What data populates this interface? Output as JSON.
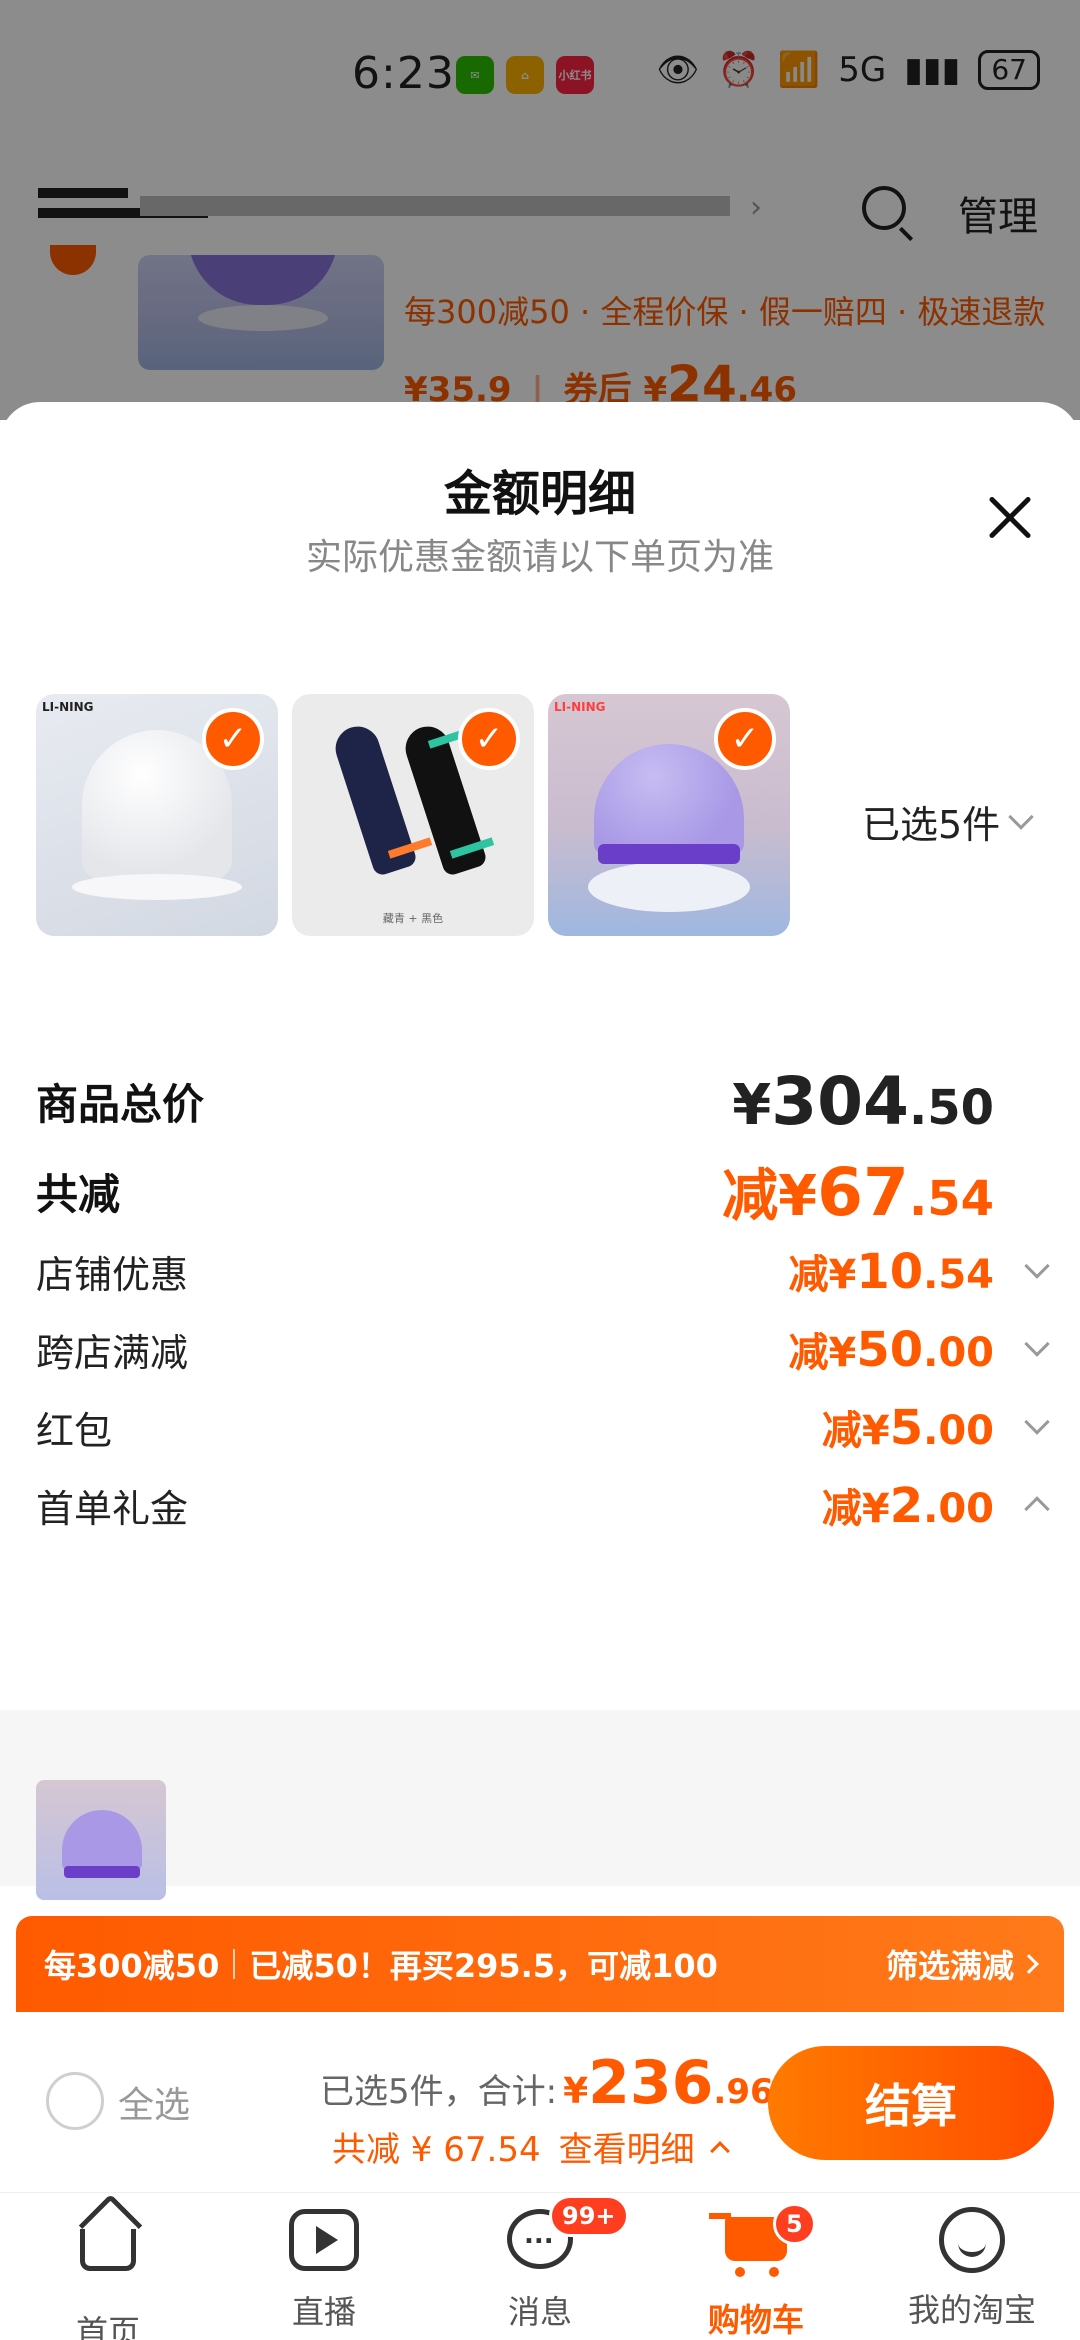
{
  "status_bar": {
    "time": "6:23",
    "apps": [
      "wechat-icon",
      "taobao-icon",
      "xiaohongshu-icon"
    ],
    "xiaohongshu_label": "小红书",
    "network": "5G",
    "battery": "67"
  },
  "background": {
    "manage_label": "管理",
    "item_tags": "每300减50 · 全程价保 · 假一赔四 · 极速退款",
    "item_price": "¥35.9",
    "coupon_label": "券后",
    "coupon_currency": "¥",
    "coupon_price_int": "24",
    "coupon_price_dec": ".46"
  },
  "sheet": {
    "title": "金额明细",
    "subtitle": "实际优惠金额请以下单页为准",
    "selected_count": "已选5件",
    "thumb2_caption": "藏青 + 黑色",
    "rows": [
      {
        "label": "商品总价",
        "prefix": "¥",
        "int": "304",
        "dec": ".50"
      },
      {
        "label": "共减",
        "prefix": "减¥",
        "int": "67",
        "dec": ".54"
      },
      {
        "label": "店铺优惠",
        "prefix": "减¥",
        "int": "10",
        "dec": ".54"
      },
      {
        "label": "跨店满减",
        "prefix": "减¥",
        "int": "50",
        "dec": ".00"
      },
      {
        "label": "红包",
        "prefix": "减¥",
        "int": "5",
        "dec": ".00"
      },
      {
        "label": "首单礼金",
        "prefix": "减¥",
        "int": "2",
        "dec": ".00"
      }
    ]
  },
  "promo_banner": {
    "rule": "每300减50",
    "message": "已减50！再买295.5，可减100",
    "filter_label": "筛选满减"
  },
  "checkout": {
    "select_all": "全选",
    "total_label": "已选5件，合计:",
    "currency": "¥",
    "total_int": "236",
    "total_dec": ".96",
    "saved_text": "共减 ¥ 67.54",
    "details_link": "查看明细",
    "button": "结算"
  },
  "tabbar": {
    "tabs": [
      {
        "label": "首页",
        "icon": "home-icon"
      },
      {
        "label": "直播",
        "icon": "live-icon"
      },
      {
        "label": "消息",
        "icon": "message-icon",
        "badge": "99+"
      },
      {
        "label": "购物车",
        "icon": "cart-icon",
        "badge": "5",
        "active": true
      },
      {
        "label": "我的淘宝",
        "icon": "profile-icon"
      }
    ]
  },
  "colors": {
    "accent": "#ff5a00",
    "text": "#222222",
    "muted": "#888888"
  }
}
